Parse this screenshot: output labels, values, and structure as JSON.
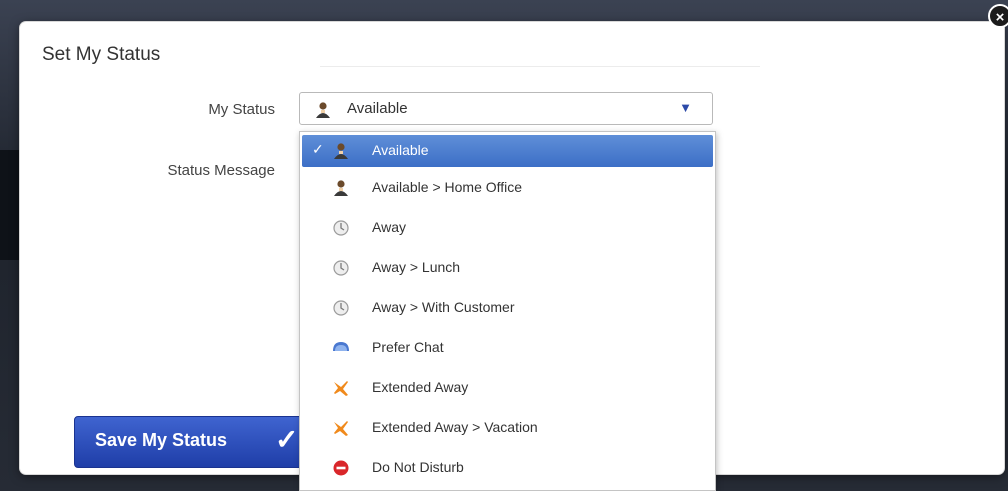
{
  "dialog": {
    "title": "Set My Status",
    "close_icon": "close-icon",
    "my_status_label": "My Status",
    "status_message_label": "Status Message",
    "save_button_label": "Save My Status",
    "save_button_icon": "checkmark-icon"
  },
  "status_select": {
    "value": "Available",
    "icon": "person-icon",
    "arrow_icon": "triangle-down-icon"
  },
  "dropdown": {
    "items": [
      {
        "label": "Available",
        "icon": "person-icon",
        "selected": true
      },
      {
        "label": "Available > Home Office",
        "icon": "person-icon",
        "selected": false
      },
      {
        "label": "Away",
        "icon": "clock-icon",
        "selected": false
      },
      {
        "label": "Away > Lunch",
        "icon": "clock-icon",
        "selected": false
      },
      {
        "label": "Away > With Customer",
        "icon": "clock-icon",
        "selected": false
      },
      {
        "label": "Prefer Chat",
        "icon": "chat-bubble-icon",
        "selected": false
      },
      {
        "label": "Extended Away",
        "icon": "airplane-icon",
        "selected": false
      },
      {
        "label": "Extended Away > Vacation",
        "icon": "airplane-icon",
        "selected": false
      },
      {
        "label": "Do Not Disturb",
        "icon": "do-not-disturb-icon",
        "selected": false
      }
    ]
  },
  "colors": {
    "accent": "#3c6fc6",
    "button": "#1f3ea8",
    "airplane": "#f08a1c",
    "do_not_disturb": "#d9262a",
    "chat": "#4a78d0"
  }
}
